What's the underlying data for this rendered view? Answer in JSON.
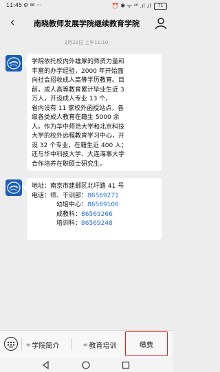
{
  "status": {
    "time": "11:45",
    "left_icons": "⚙ ✉ ···",
    "right_icons": "⏰ ✱ ᯤ ⁴⁶ .ıl .ıl",
    "battery": "71"
  },
  "header": {
    "title": "南晓教师发展学院继续教育学院"
  },
  "timestamp": "2月22日 上午11:10",
  "messages": {
    "msg1_lines": [
      "学院依托校内外雄厚的师资力量和",
      "丰富的办学经验，2000 年开始面",
      "向社会招收成人高等学历教育。目",
      "前，成人高等教育累计毕业生近 3",
      "万人，开设成人专业 13 个，",
      "省内设有 11 家校外函授站点，各",
      "级各类成人教育在籍生 5000 余",
      "人。作为华中师范大学和北京科技",
      "大学的校外远程教育学习中心，开",
      "设 32 个专业，在籍生近 400 人；",
      "还与华中科技大学、大连海事大学",
      "合作培养在职硕士研究生。"
    ],
    "address_label": "地址：",
    "address_value": "南京市建邺区北圩路 41 号",
    "phone_label": "电话：",
    "contacts": [
      {
        "name": "师、干训部：",
        "phone": "86569271"
      },
      {
        "name": "幼培中心：",
        "phone": "86569106"
      },
      {
        "name": "成教科：",
        "phone": "86569266"
      },
      {
        "name": "培训科：",
        "phone": "86569248"
      }
    ]
  },
  "bottom_menu": {
    "item1": "学院简介",
    "item2": "教育培训",
    "item3": "缴费"
  },
  "colors": {
    "accent_phone": "#2a6fd6",
    "highlight_border": "#e02020",
    "avatar_bg": "#1c5fb4"
  }
}
